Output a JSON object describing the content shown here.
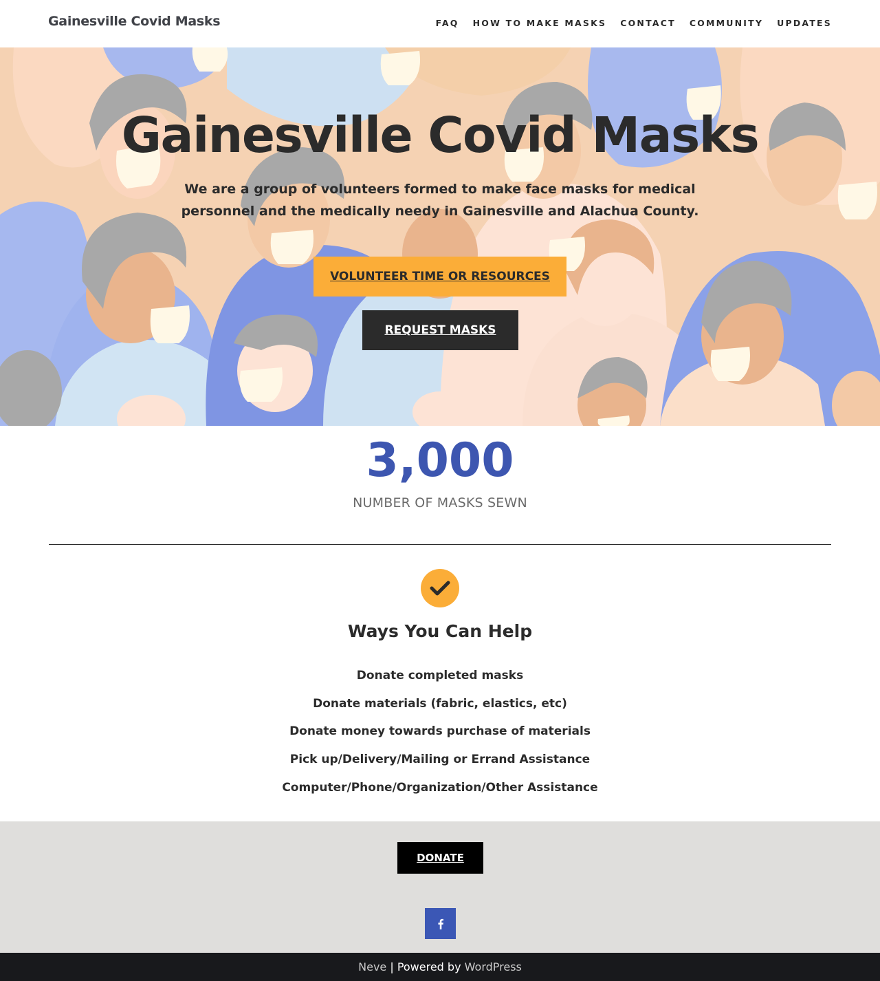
{
  "header": {
    "brand": "Gainesville Covid Masks",
    "nav": [
      "FAQ",
      "How to make masks",
      "Contact",
      "Community",
      "Updates"
    ]
  },
  "hero": {
    "title": "Gainesville Covid Masks",
    "subtitle": "We are a group of volunteers formed to make face masks for medical personnel and the medically needy in Gainesville and Alachua County.",
    "volunteer_button": "Volunteer Time or Resources",
    "request_button": "Request Masks"
  },
  "counter": {
    "value": "3,000",
    "label": "Number of masks sewn"
  },
  "ways": {
    "title": "Ways You Can Help",
    "items": [
      "Donate completed masks",
      "Donate materials (fabric, elastics, etc)",
      "Donate money towards purchase of materials",
      "Pick up/Delivery/Mailing or Errand Assistance",
      "Computer/Phone/Organization/Other Assistance"
    ]
  },
  "footer": {
    "donate_button": "Donate",
    "social_icon": "facebook-icon",
    "theme_link": "Neve",
    "powered_by": " | Powered by ",
    "wp_link": "WordPress"
  },
  "colors": {
    "accent_orange": "#fbad38",
    "dark": "#2b2b2b",
    "counter_blue": "#3d56b0",
    "facebook_blue": "#3b57b5",
    "footer_gray": "#dfdedc",
    "footer_dark": "#18191c"
  }
}
